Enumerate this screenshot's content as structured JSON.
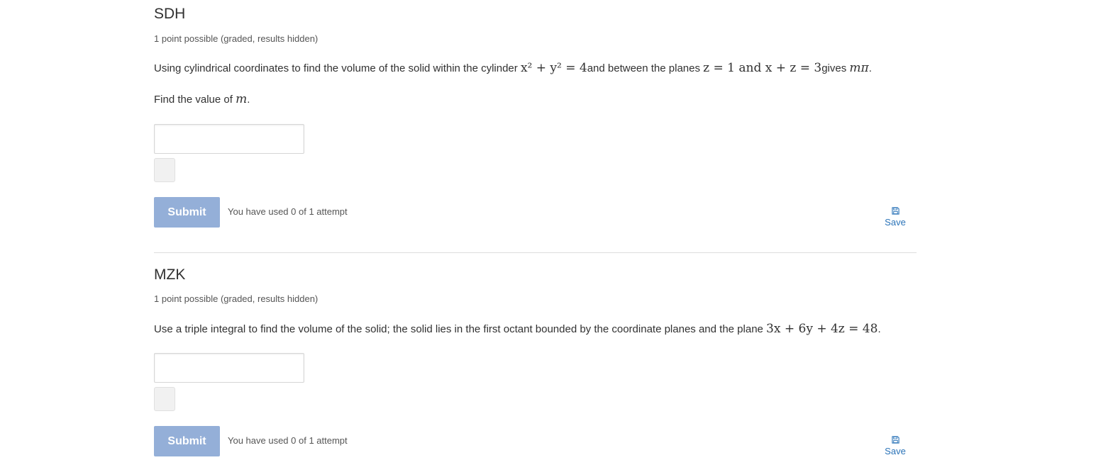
{
  "problems": [
    {
      "title": "SDH",
      "points": "1 point possible (graded, results hidden)",
      "prompt": {
        "t1": "Using cylindrical coordinates to find the volume of the solid within the cylinder ",
        "m1": "x² + y² = 4",
        "t2": "and between the planes ",
        "m2": "z = 1 and x + z = 3",
        "t3": "gives ",
        "m3": "mπ",
        "t4": "."
      },
      "prompt2": {
        "t1": "Find the value of ",
        "m1": "m",
        "t2": "."
      },
      "answer_value": "",
      "submit_label": "Submit",
      "attempts": "You have used 0 of 1 attempt",
      "save_label": "Save"
    },
    {
      "title": "MZK",
      "points": "1 point possible (graded, results hidden)",
      "prompt": {
        "t1": "Use a triple integral to find the volume of the solid; the solid lies in the first octant bounded by the coordinate planes and the plane ",
        "m1": "3x + 6y + 4z = 48",
        "t2": "."
      },
      "answer_value": "",
      "submit_label": "Submit",
      "attempts": "You have used 0 of 1 attempt",
      "save_label": "Save"
    }
  ],
  "colors": {
    "submit_bg": "#94afd8",
    "link": "#2a73b8",
    "text": "#313131",
    "divider": "#dddddd"
  },
  "icons": {
    "save": "floppy-disk-icon"
  }
}
